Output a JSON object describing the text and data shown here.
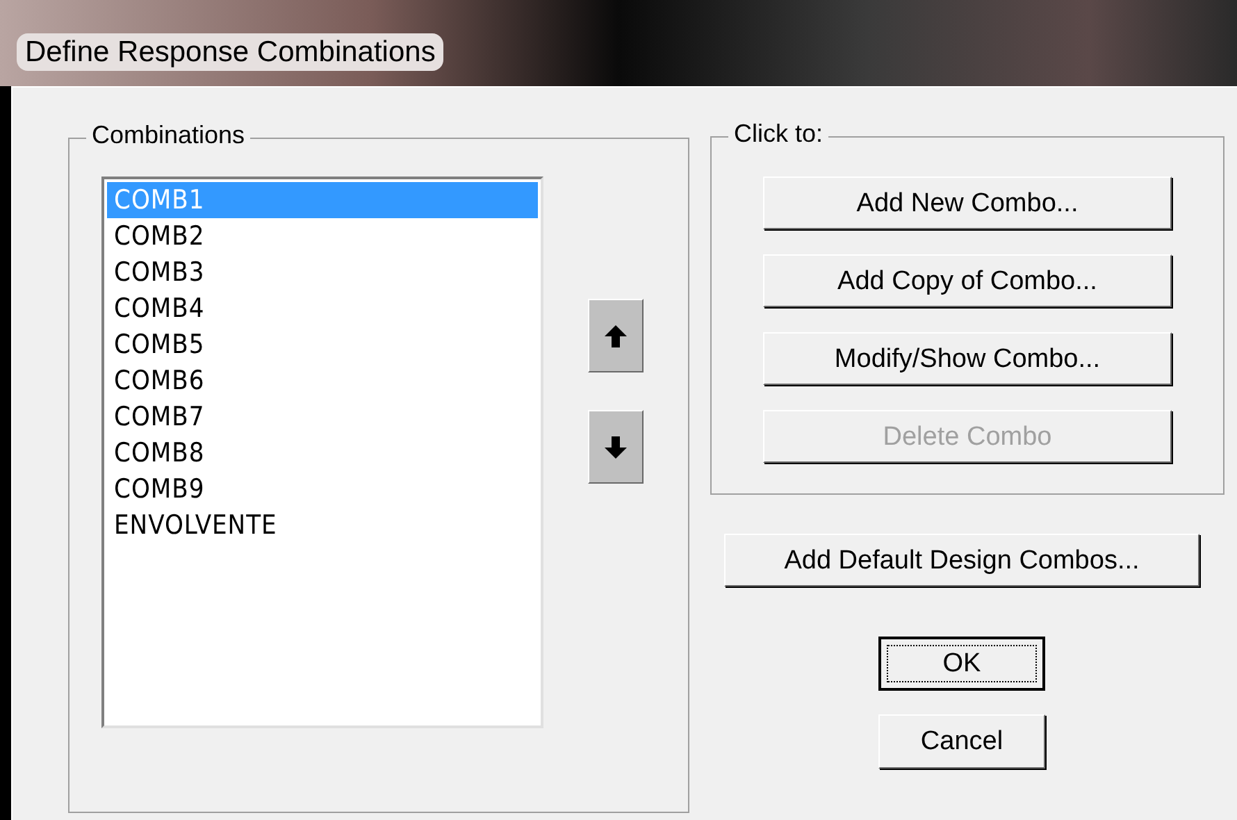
{
  "window": {
    "title": "Define Response Combinations"
  },
  "combinations": {
    "label": "Combinations",
    "items": [
      {
        "label": "COMB1",
        "selected": true
      },
      {
        "label": "COMB2",
        "selected": false
      },
      {
        "label": "COMB3",
        "selected": false
      },
      {
        "label": "COMB4",
        "selected": false
      },
      {
        "label": "COMB5",
        "selected": false
      },
      {
        "label": "COMB6",
        "selected": false
      },
      {
        "label": "COMB7",
        "selected": false
      },
      {
        "label": "COMB8",
        "selected": false
      },
      {
        "label": "COMB9",
        "selected": false
      },
      {
        "label": "ENVOLVENTE",
        "selected": false
      }
    ]
  },
  "click_to": {
    "label": "Click to:",
    "buttons": [
      {
        "label": "Add New Combo...",
        "disabled": false
      },
      {
        "label": "Add Copy of Combo...",
        "disabled": false
      },
      {
        "label": "Modify/Show Combo...",
        "disabled": false
      },
      {
        "label": "Delete Combo",
        "disabled": true
      }
    ]
  },
  "default_button": {
    "label": "Add Default Design Combos..."
  },
  "buttons": [
    {
      "label": "OK",
      "focused": true
    },
    {
      "label": "Cancel",
      "focused": false
    }
  ]
}
